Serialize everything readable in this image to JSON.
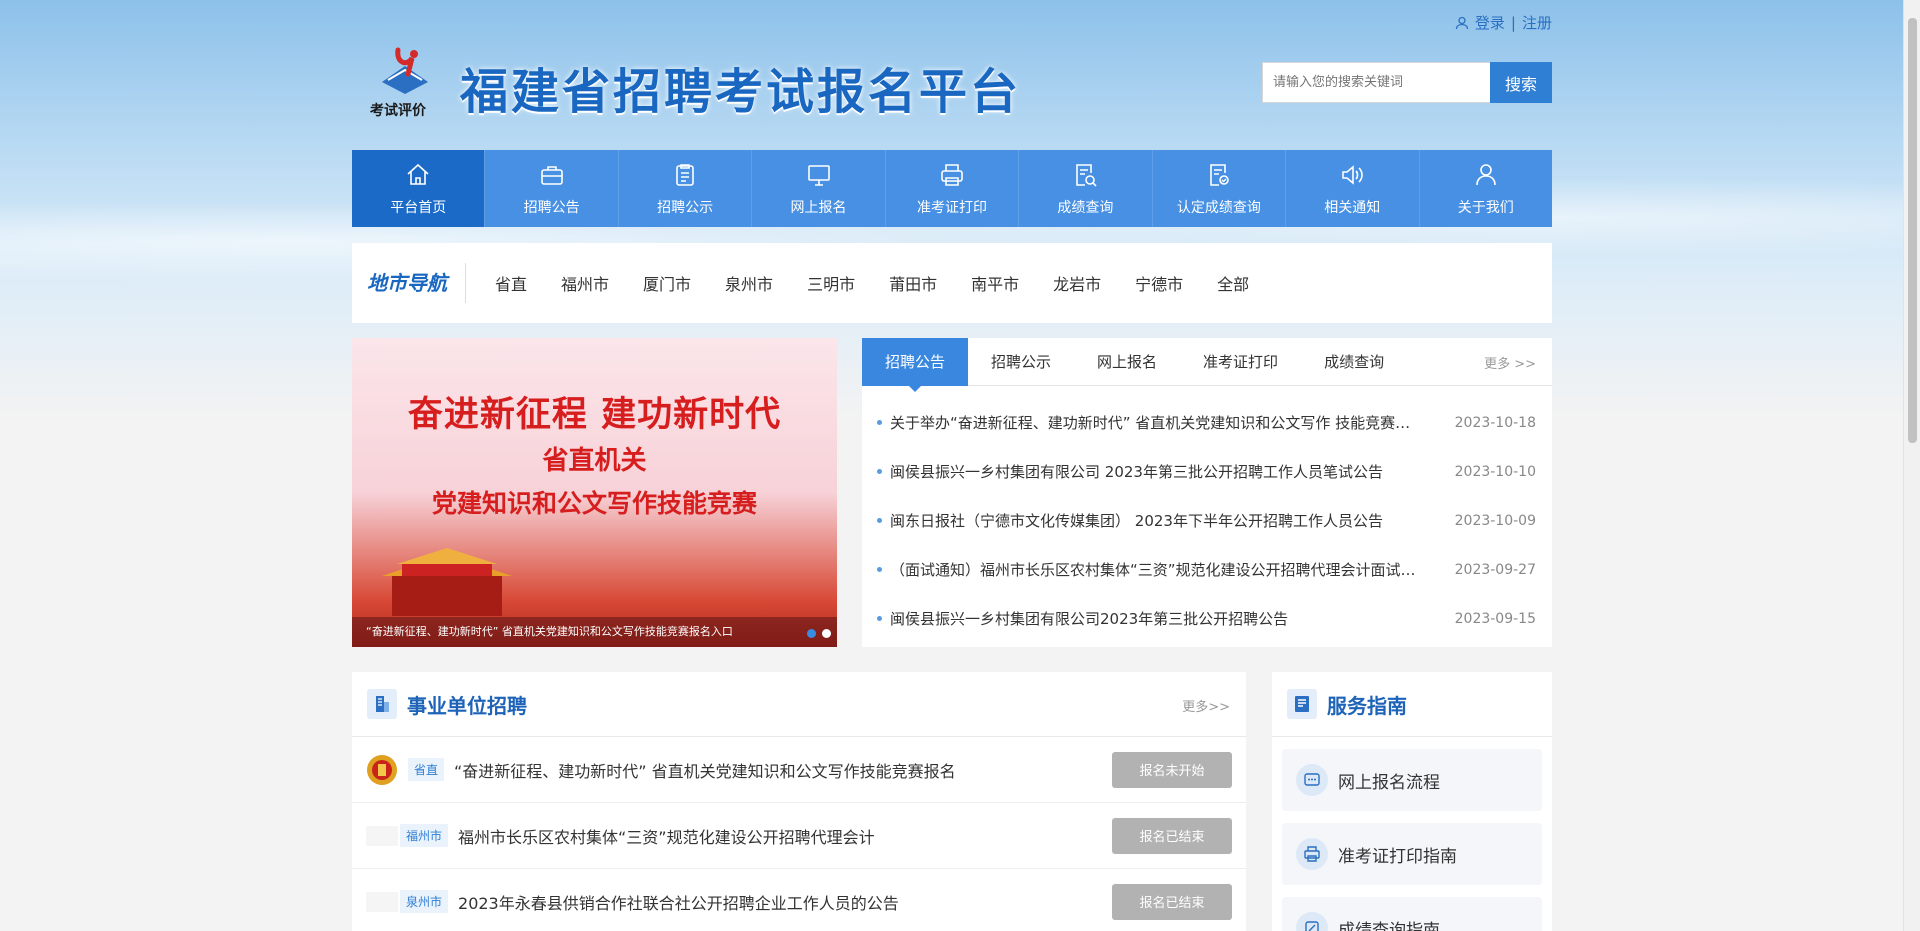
{
  "header": {
    "login": "登录",
    "separator": "|",
    "register": "注册",
    "logo_text": "考试评价",
    "site_title": "福建省招聘考试报名平台",
    "search_placeholder": "请输入您的搜索关键词",
    "search_button": "搜索"
  },
  "nav": [
    {
      "label": "平台首页",
      "icon": "home-icon"
    },
    {
      "label": "招聘公告",
      "icon": "briefcase-icon"
    },
    {
      "label": "招聘公示",
      "icon": "clipboard-icon"
    },
    {
      "label": "网上报名",
      "icon": "monitor-icon"
    },
    {
      "label": "准考证打印",
      "icon": "printer-icon"
    },
    {
      "label": "成绩查询",
      "icon": "search-doc-icon"
    },
    {
      "label": "认定成绩查询",
      "icon": "verify-doc-icon"
    },
    {
      "label": "相关通知",
      "icon": "speaker-icon"
    },
    {
      "label": "关于我们",
      "icon": "user-icon"
    }
  ],
  "region": {
    "title": "地市导航",
    "items": [
      "省直",
      "福州市",
      "厦门市",
      "泉州市",
      "三明市",
      "莆田市",
      "南平市",
      "龙岩市",
      "宁德市",
      "全部"
    ]
  },
  "banner": {
    "line1": "奋进新征程  建功新时代",
    "line2": "省直机关",
    "line3": "党建知识和公文写作技能竞赛",
    "caption": "“奋进新征程、建功新时代” 省直机关党建知识和公文写作技能竞赛报名入口"
  },
  "news": {
    "tabs": [
      "招聘公告",
      "招聘公示",
      "网上报名",
      "准考证打印",
      "成绩查询"
    ],
    "more": "更多 >>",
    "items": [
      {
        "title": "关于举办“奋进新征程、建功新时代” 省直机关党建知识和公文写作 技能竞赛的通知",
        "date": "2023-10-18"
      },
      {
        "title": "闽侯县振兴一乡村集团有限公司 2023年第三批公开招聘工作人员笔试公告",
        "date": "2023-10-10"
      },
      {
        "title": "闽东日报社（宁德市文化传媒集团） 2023年下半年公开招聘工作人员公告",
        "date": "2023-10-09"
      },
      {
        "title": "（面试通知）福州市长乐区农村集体“三资”规范化建设公开招聘代理会计面试通知",
        "date": "2023-09-27"
      },
      {
        "title": "闽侯县振兴一乡村集团有限公司2023年第三批公开招聘公告",
        "date": "2023-09-15"
      }
    ]
  },
  "jobs": {
    "title": "事业单位招聘",
    "more": "更多>>",
    "items": [
      {
        "tag": "省直",
        "title": "“奋进新征程、建功新时代” 省直机关党建知识和公文写作技能竞赛报名",
        "status": "报名未开始"
      },
      {
        "tag": "福州市",
        "title": "福州市长乐区农村集体“三资”规范化建设公开招聘代理会计",
        "status": "报名已结束"
      },
      {
        "tag": "泉州市",
        "title": "2023年永春县供销合作社联合社公开招聘企业工作人员的公告",
        "status": "报名已结束"
      }
    ]
  },
  "guide": {
    "title": "服务指南",
    "items": [
      "网上报名流程",
      "准考证打印指南",
      "成绩查询指南"
    ]
  },
  "colors": {
    "primary": "#4790e3",
    "active": "#1b6ac7",
    "title": "#1967c1",
    "button_gray": "#b2b2b2"
  }
}
